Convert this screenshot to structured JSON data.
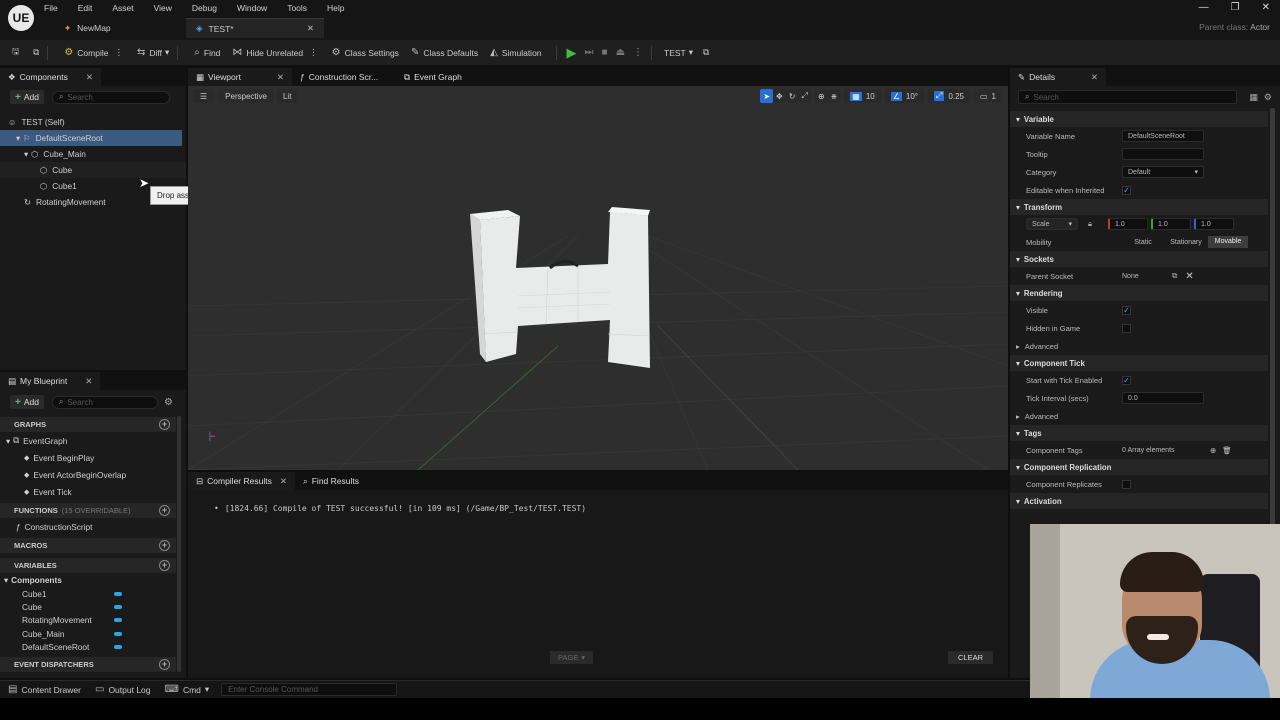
{
  "app": {
    "logo": "UE",
    "menu": [
      "File",
      "Edit",
      "Asset",
      "View",
      "Debug",
      "Window",
      "Tools",
      "Help"
    ],
    "doc_tabs": [
      {
        "label": "NewMap"
      },
      {
        "label": "TEST*"
      }
    ],
    "parent_class_label": "Parent class:",
    "parent_class_value": "Actor"
  },
  "toolbar": {
    "compile": "Compile",
    "diff": "Diff",
    "find": "Find",
    "hide_unrelated": "Hide Unrelated",
    "class_settings": "Class Settings",
    "class_defaults": "Class Defaults",
    "simulation": "Simulation",
    "debug_target": "TEST"
  },
  "components": {
    "tab": "Components",
    "add": "Add",
    "search_placeholder": "Search",
    "self": "TEST (Self)",
    "items": [
      "DefaultSceneRoot",
      "Cube_Main",
      "Cube",
      "Cube1",
      "RotatingMovement"
    ],
    "tooltip": "Drop asset here to add a component."
  },
  "blueprint": {
    "tab": "My Blueprint",
    "add": "Add",
    "search_placeholder": "Search",
    "graphs": "GRAPHS",
    "event_graph": "EventGraph",
    "events": [
      "Event BeginPlay",
      "Event ActorBeginOverlap",
      "Event Tick"
    ],
    "functions": "FUNCTIONS",
    "functions_note": "(15 OVERRIDABLE)",
    "construction": "ConstructionScript",
    "macros": "MACROS",
    "variables": "VARIABLES",
    "var_group": "Components",
    "vars": [
      "Cube1",
      "Cube",
      "RotatingMovement",
      "Cube_Main",
      "DefaultSceneRoot"
    ],
    "dispatchers": "EVENT DISPATCHERS"
  },
  "editor_tabs": [
    "Viewport",
    "Construction Scr...",
    "Event Graph"
  ],
  "viewport": {
    "perspective": "Perspective",
    "lit": "Lit",
    "grid": "10",
    "angle": "10°",
    "scale": "0.25",
    "cam": "1"
  },
  "compiler": {
    "tab1": "Compiler Results",
    "tab2": "Find Results",
    "message": "[1824.66] Compile of TEST successful! [in 109 ms] (/Game/BP_Test/TEST.TEST)",
    "page": "PAGE",
    "clear": "CLEAR"
  },
  "details": {
    "tab": "Details",
    "search_placeholder": "Search",
    "sections": {
      "variable": "Variable",
      "transform": "Transform",
      "sockets": "Sockets",
      "rendering": "Rendering",
      "component_tick": "Component Tick",
      "tags": "Tags",
      "component_replication": "Component Replication",
      "activation": "Activation"
    },
    "variable_name_label": "Variable Name",
    "variable_name_value": "DefaultSceneRoot",
    "tooltip_label": "Tooltip",
    "category_label": "Category",
    "category_value": "Default",
    "editable_label": "Editable when Inherited",
    "scale_label": "Scale",
    "scale_x": "1.0",
    "scale_y": "1.0",
    "scale_z": "1.0",
    "mobility_label": "Mobility",
    "mobility_options": [
      "Static",
      "Stationary",
      "Movable"
    ],
    "parent_socket_label": "Parent Socket",
    "parent_socket_value": "None",
    "visible_label": "Visible",
    "hidden_label": "Hidden in Game",
    "advanced": "Advanced",
    "tick_enabled_label": "Start with Tick Enabled",
    "tick_interval_label": "Tick Interval (secs)",
    "tick_interval_value": "0.0",
    "advanced2": "Advanced",
    "component_tags_label": "Component Tags",
    "component_tags_value": "0 Array elements",
    "replicates_label": "Component Replicates"
  },
  "statusbar": {
    "content_drawer": "Content Drawer",
    "output_log": "Output Log",
    "cmd": "Cmd",
    "console_placeholder": "Enter Console Command"
  },
  "colors": {
    "accent": "#2aa7e0",
    "play": "#3fbf3f",
    "selection": "#3a5a80"
  }
}
